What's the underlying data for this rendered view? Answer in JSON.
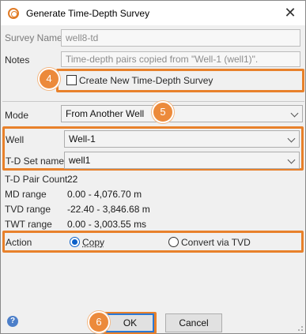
{
  "window": {
    "title": "Generate Time-Depth Survey",
    "close_glyph": "✕"
  },
  "form": {
    "survey_name": {
      "label": "Survey Name",
      "value": "well8-td"
    },
    "notes": {
      "label": "Notes",
      "value": "Time-depth pairs copied from \"Well-1 (well1)\"."
    },
    "create_new": {
      "label": "Create New Time-Depth Survey",
      "checked": false
    },
    "mode": {
      "label": "Mode",
      "value": "From Another Well"
    },
    "well": {
      "label": "Well",
      "value": "Well-1"
    },
    "td_set": {
      "label": "T-D Set name",
      "value": "well1"
    },
    "stats": [
      {
        "label": "T-D Pair Count",
        "value": "22"
      },
      {
        "label": "MD range",
        "value": "0.00 - 4,076.70 m"
      },
      {
        "label": "TVD range",
        "value": "-22.40 - 3,846.68 m"
      },
      {
        "label": "TWT range",
        "value": "0.00 - 3,003.55 ms"
      }
    ],
    "action": {
      "label": "Action",
      "options": [
        {
          "label": "Copy",
          "selected": true
        },
        {
          "label": "Convert via TVD",
          "selected": false
        }
      ]
    }
  },
  "buttons": {
    "ok": "OK",
    "cancel": "Cancel"
  },
  "callouts": {
    "step_4": "4",
    "step_5": "5",
    "step_6": "6"
  },
  "colors": {
    "highlight": "#e8812b",
    "callout": "#ec8a3b",
    "radio_selected": "#0a60c9",
    "help_icon": "#4c7fc9"
  },
  "icons": {
    "app": "time-depth-survey-icon",
    "help": "help-icon",
    "close": "close-icon"
  }
}
